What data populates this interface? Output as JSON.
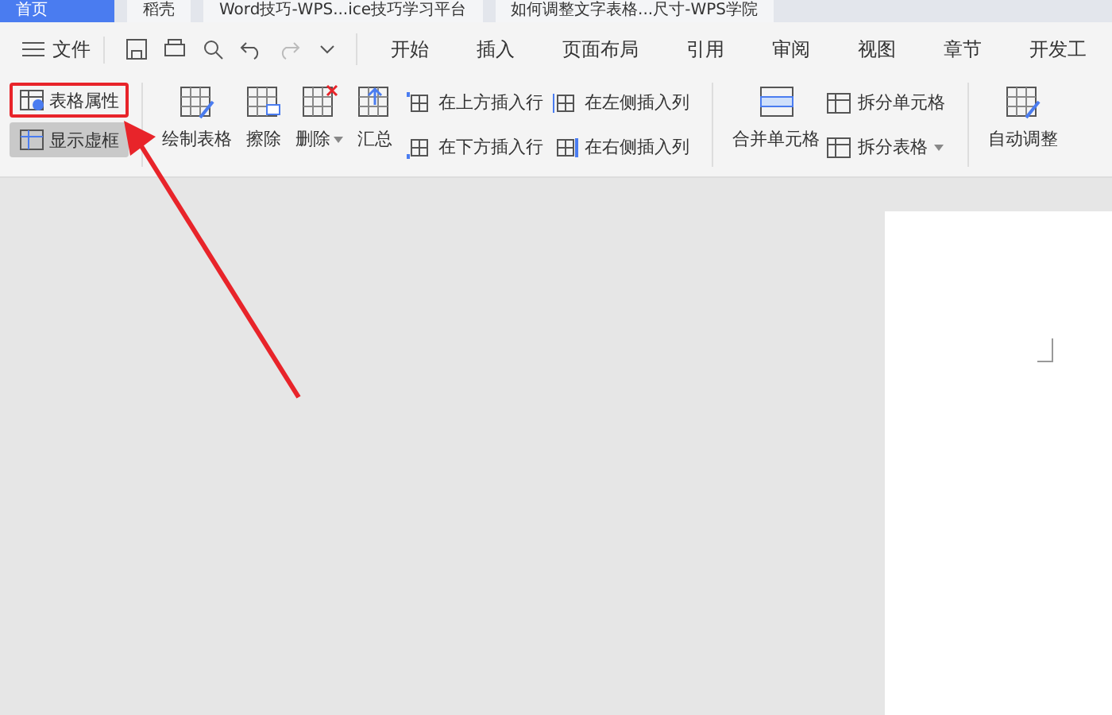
{
  "browser_tabs": [
    {
      "label": "首页",
      "selected": true
    },
    {
      "label": "稻壳",
      "selected": false
    },
    {
      "label": "Word技巧-WPS...ice技巧学习平台",
      "selected": false
    },
    {
      "label": "如何调整文字表格...尺寸-WPS学院",
      "selected": false
    }
  ],
  "menu": {
    "file": "文件",
    "ribbon_tabs": [
      "开始",
      "插入",
      "页面布局",
      "引用",
      "审阅",
      "视图",
      "章节",
      "开发工"
    ]
  },
  "ribbon": {
    "small_left": [
      {
        "label": "表格属性",
        "kind": "props",
        "highlighted": true,
        "on": false
      },
      {
        "label": "显示虚框",
        "kind": "grid",
        "highlighted": false,
        "on": true
      }
    ],
    "large": [
      {
        "label": "绘制表格",
        "kind": "draw",
        "dropdown": false
      },
      {
        "label": "擦除",
        "kind": "erase",
        "dropdown": false
      },
      {
        "label": "删除",
        "kind": "delete",
        "dropdown": true
      },
      {
        "label": "汇总",
        "kind": "sum",
        "dropdown": false
      }
    ],
    "insert": [
      {
        "label": "在上方插入行",
        "kind": "above"
      },
      {
        "label": "在下方插入行",
        "kind": "below"
      },
      {
        "label": "在左侧插入列",
        "kind": "left"
      },
      {
        "label": "在右侧插入列",
        "kind": "right"
      }
    ],
    "merge": {
      "label": "合并单元格"
    },
    "split": [
      {
        "label": "拆分单元格",
        "dropdown": false
      },
      {
        "label": "拆分表格",
        "dropdown": true
      }
    ],
    "auto": {
      "label": "自动调整"
    }
  },
  "annotation": {
    "arrow": true
  }
}
